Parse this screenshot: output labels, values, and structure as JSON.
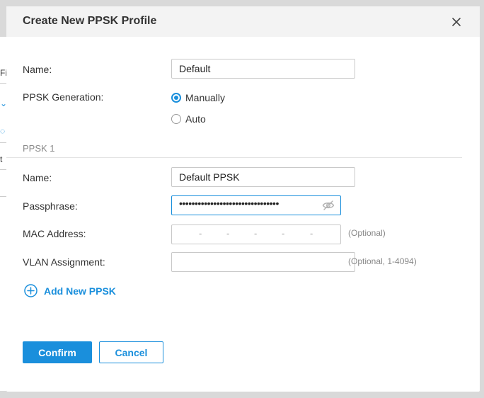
{
  "background": {
    "fragments": [
      "Fi",
      "t"
    ]
  },
  "dialog": {
    "title": "Create New PPSK Profile",
    "close_icon": "close-icon"
  },
  "profile": {
    "name_label": "Name:",
    "name_value": "Default",
    "generation_label": "PPSK Generation:",
    "generation_options": [
      {
        "label": "Manually",
        "selected": true
      },
      {
        "label": "Auto",
        "selected": false
      }
    ]
  },
  "ppsk": {
    "section_title": "PPSK 1",
    "name_label": "Name:",
    "name_value": "Default PPSK",
    "passphrase_label": "Passphrase:",
    "passphrase_masked": "••••••••••••••••••••••••••••••••",
    "passphrase_visibility_icon": "eye-hidden-icon",
    "mac_label": "MAC Address:",
    "mac_separator": "-",
    "mac_hint": "(Optional)",
    "vlan_label": "VLAN Assignment:",
    "vlan_value": "",
    "vlan_hint": "(Optional, 1-4094)"
  },
  "add_ppsk": {
    "label": "Add New PPSK",
    "icon": "plus-circle-icon"
  },
  "footer": {
    "confirm_label": "Confirm",
    "cancel_label": "Cancel"
  },
  "colors": {
    "accent": "#1a8fdc",
    "header_bg": "#f3f3f3",
    "overlay": "#d9d9d9"
  }
}
